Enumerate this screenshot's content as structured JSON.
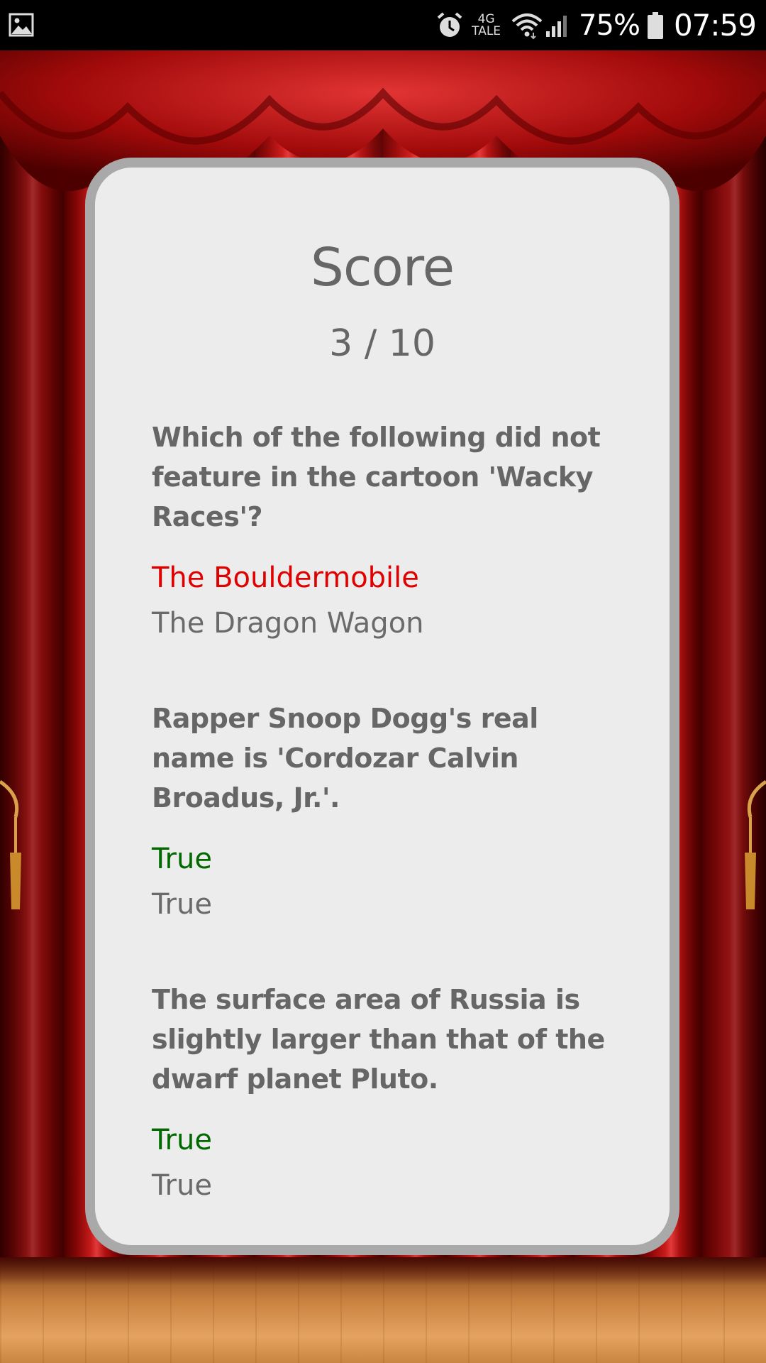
{
  "status_bar": {
    "network_label": "4G",
    "network_sub_label": "TALE",
    "battery_percent": "75%",
    "time": "07:59",
    "icons": [
      "gallery-icon",
      "alarm-icon",
      "wifi-icon",
      "signal-icon",
      "battery-icon"
    ]
  },
  "score_card": {
    "title": "Score",
    "score_text": "3 / 10",
    "items": [
      {
        "question": "Which of the following did not feature in the cartoon 'Wacky Races'?",
        "user_answer": "The Bouldermobile",
        "user_answer_color": "#e00000",
        "correct_answer": "The Dragon Wagon"
      },
      {
        "question": "Rapper Snoop Dogg's real name is 'Cordozar Calvin Broadus, Jr.'.",
        "user_answer": "True",
        "user_answer_color": "#006a00",
        "correct_answer": "True"
      },
      {
        "question": "The surface area of Russia is slightly larger than that of the dwarf planet Pluto.",
        "user_answer": "True",
        "user_answer_color": "#006a00",
        "correct_answer": "True"
      }
    ]
  },
  "colors": {
    "card_background": "#ececec",
    "card_border": "#a9a9a9",
    "text_gray": "#666666",
    "wrong": "#e00000",
    "right": "#006a00"
  }
}
